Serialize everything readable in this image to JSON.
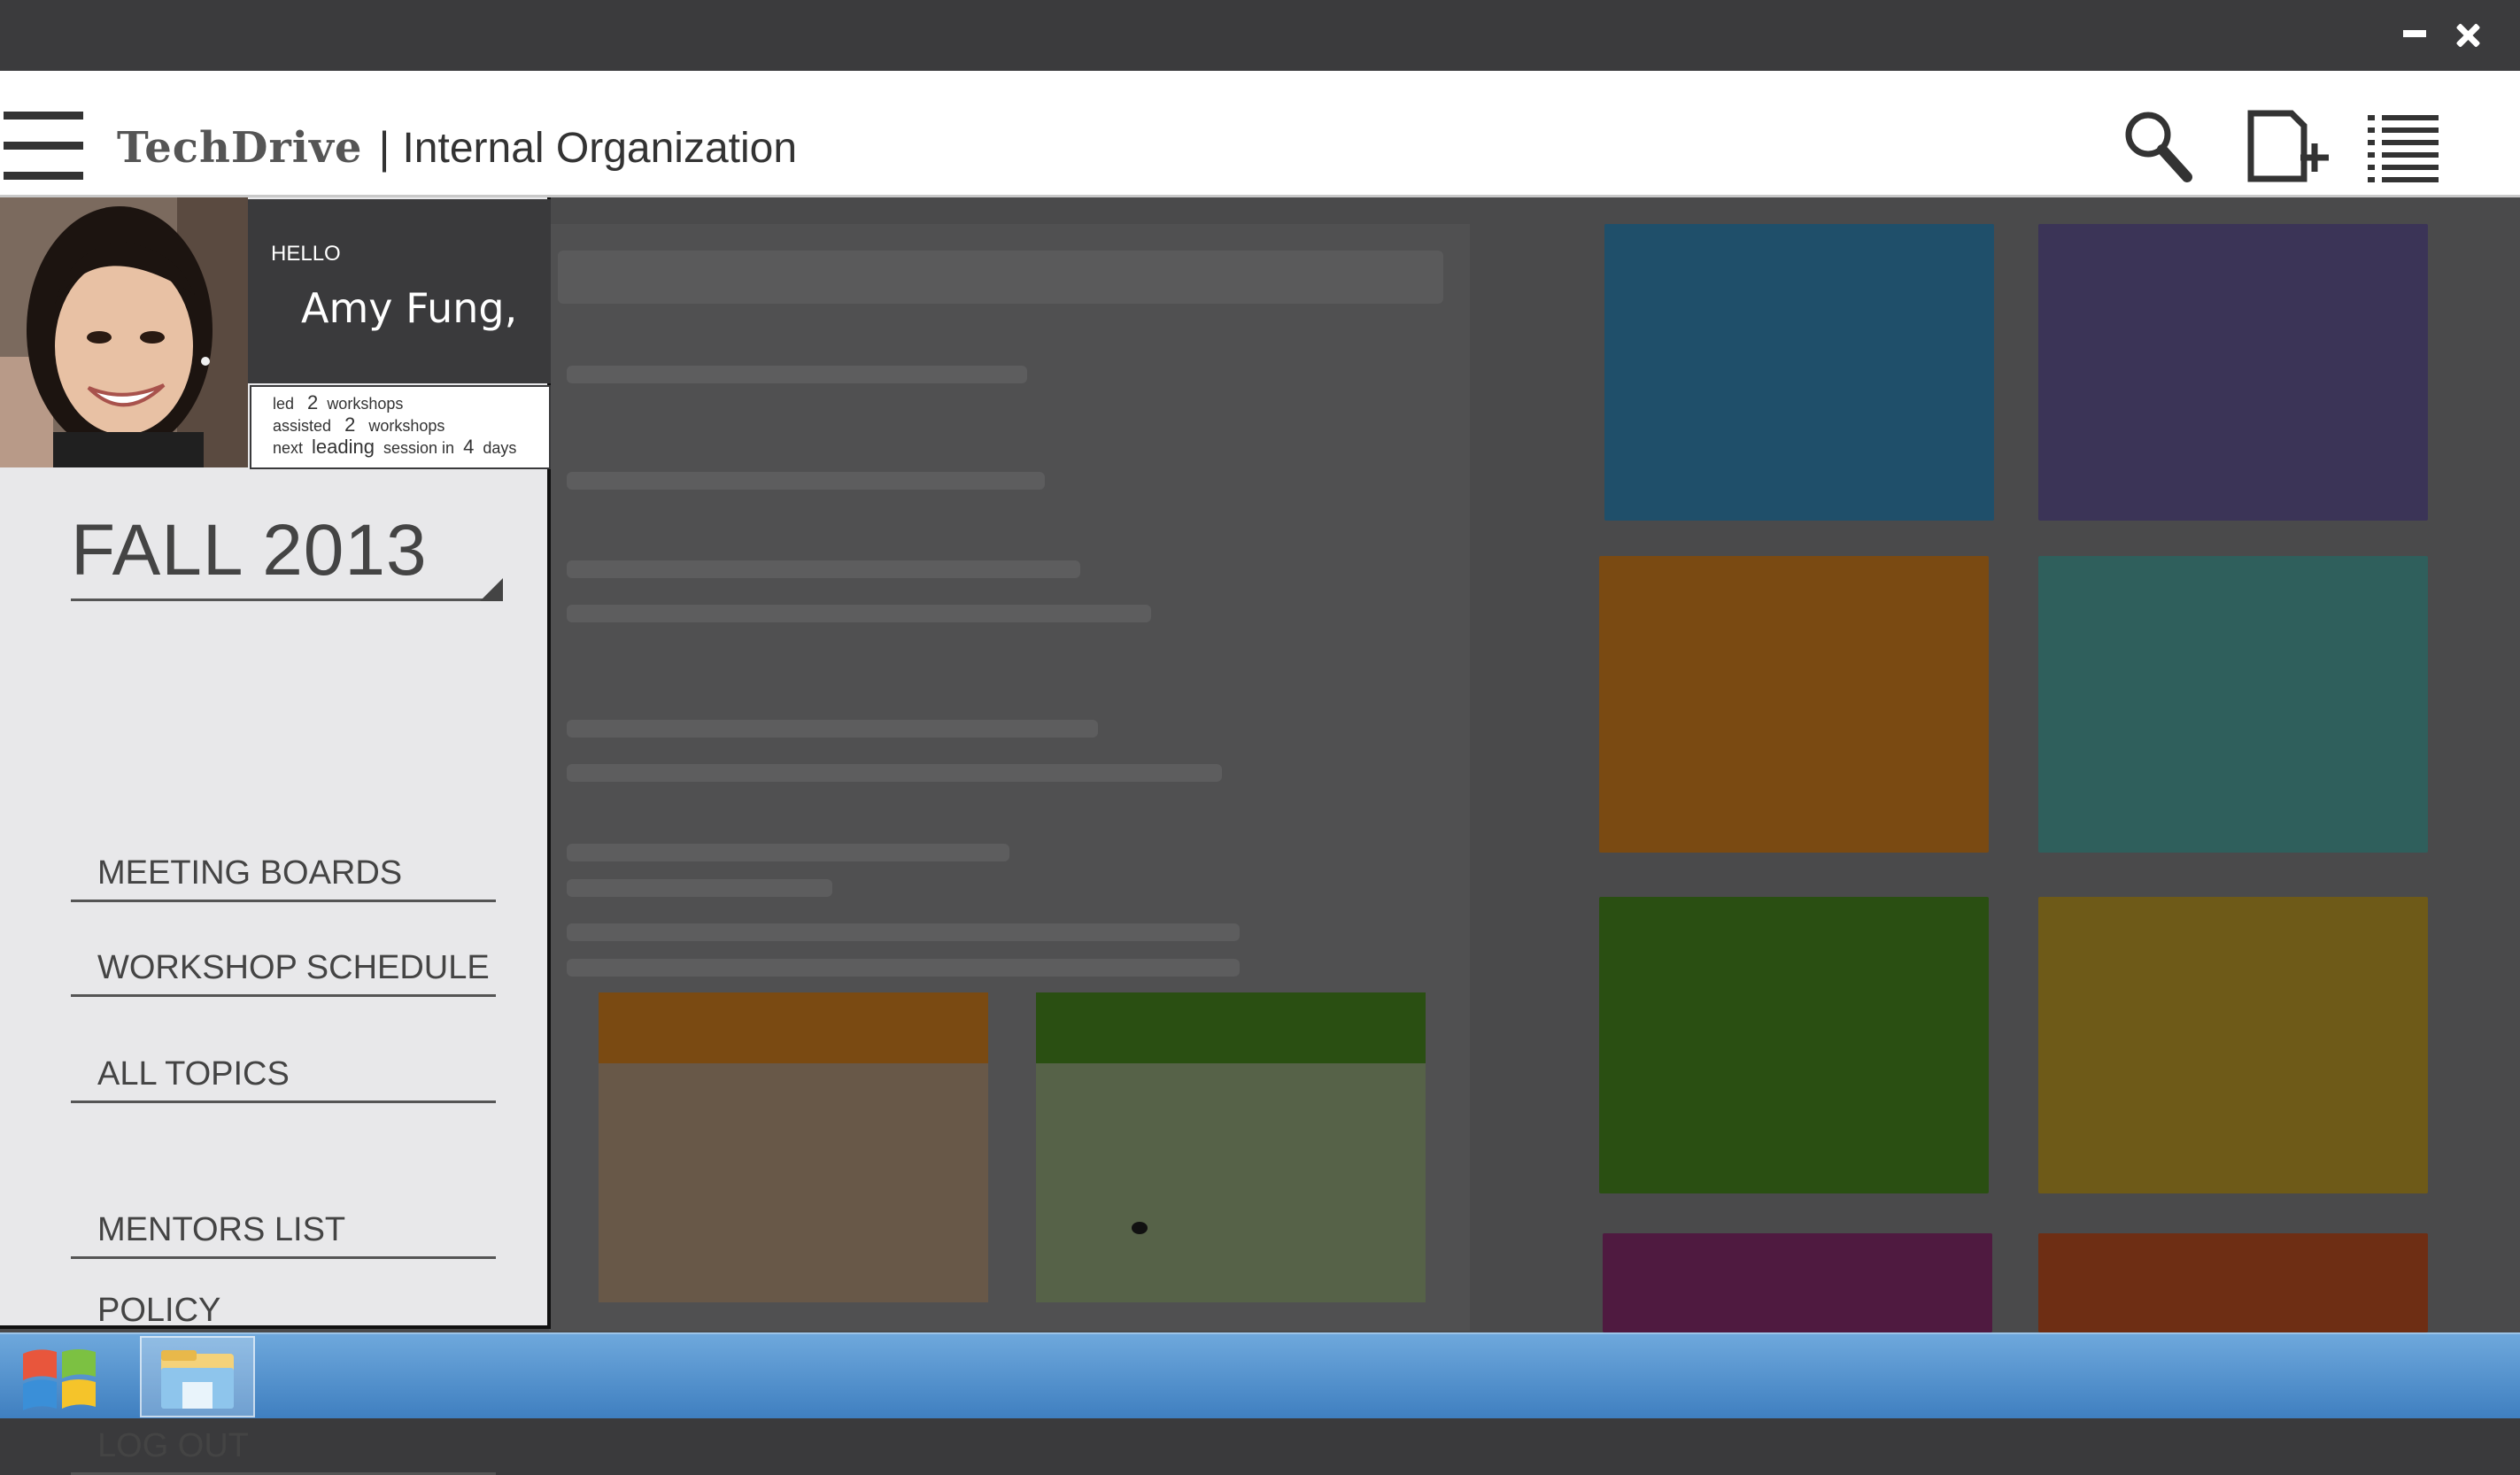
{
  "window": {
    "minimize_icon": "minimize-icon",
    "close_icon": "close-icon"
  },
  "header": {
    "brand": "TechDrive",
    "separator": "|",
    "org": "Internal Organization",
    "icons": [
      "menu-icon",
      "search-icon",
      "new-document-icon",
      "list-icon"
    ]
  },
  "profile": {
    "greeting": "HELLO",
    "name": "Amy Fung,",
    "stats": {
      "led_label": "led",
      "led_count": "2",
      "led_unit": "workshops",
      "assisted_label": "assisted",
      "assisted_count": "2",
      "assisted_unit": "workshops",
      "next_label": "next",
      "next_type": "leading",
      "next_mid": "session in",
      "next_days": "4",
      "next_unit": "days"
    }
  },
  "menu": {
    "term": "FALL 2013",
    "items": [
      {
        "label": "MEETING BOARDS"
      },
      {
        "label": "WORKSHOP SCHEDULE"
      },
      {
        "label": "ALL TOPICS"
      },
      {
        "label": "MENTORS LIST"
      },
      {
        "label": "POLICY"
      },
      {
        "label": "LOG OUT"
      }
    ]
  },
  "background_tiles": {
    "colors": [
      "#1f4f6a",
      "#3b3457",
      "#7a4a12",
      "#2f5f5c",
      "#2a4f12",
      "#6e5a18",
      "#4f1a40",
      "#6e2e14"
    ]
  },
  "taskbar": {
    "icons": [
      "windows-start-icon",
      "file-explorer-icon"
    ]
  }
}
